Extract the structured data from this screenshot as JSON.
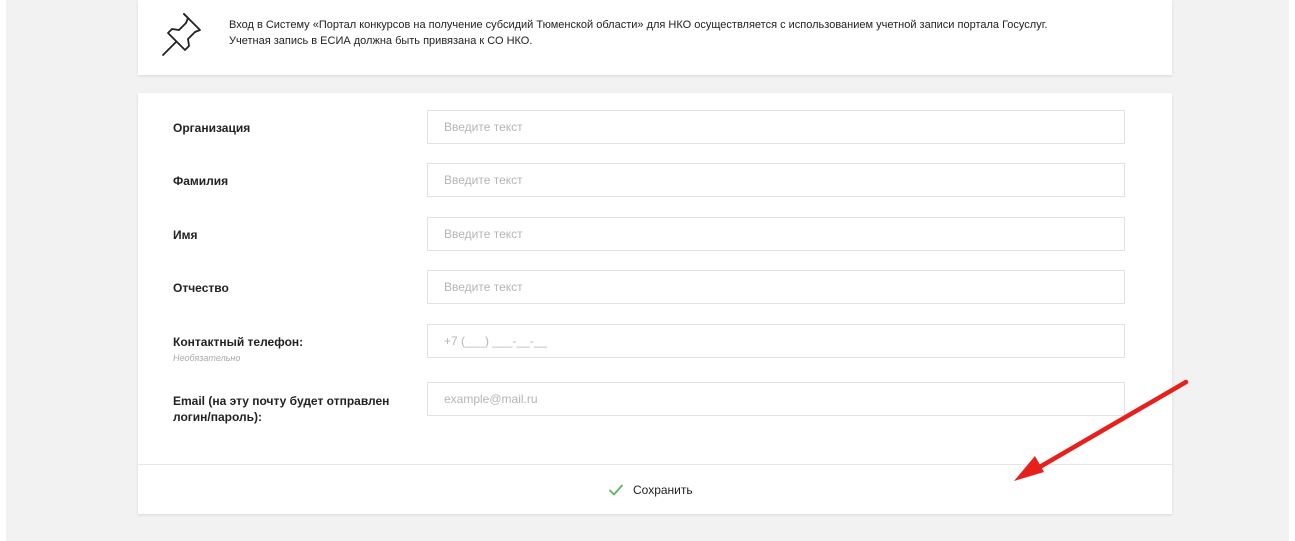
{
  "notice": {
    "icon": "pushpin-icon",
    "line1": "Вход в Систему «Портал конкурсов на получение субсидий Тюменской области» для НКО осуществляется с использованием учетной записи портала Госуслуг.",
    "line2": "Учетная запись в ЕСИА должна быть привязана к СО НКО."
  },
  "form": {
    "fields": [
      {
        "label": "Организация",
        "placeholder": "Введите текст"
      },
      {
        "label": "Фамилия",
        "placeholder": "Введите текст"
      },
      {
        "label": "Имя",
        "placeholder": "Введите текст"
      },
      {
        "label": "Отчество",
        "placeholder": "Введите текст"
      },
      {
        "label": "Контактный телефон:",
        "hint": "Необязательно",
        "placeholder": "+7 (___) ___-__-__"
      },
      {
        "label_line1": "Email (на эту почту будет отправлен",
        "label_line2": "логин/пароль):",
        "placeholder": "example@mail.ru"
      }
    ],
    "save_label": "Сохранить"
  },
  "colors": {
    "check": "#5cb85c",
    "arrow": "#e8201c"
  }
}
